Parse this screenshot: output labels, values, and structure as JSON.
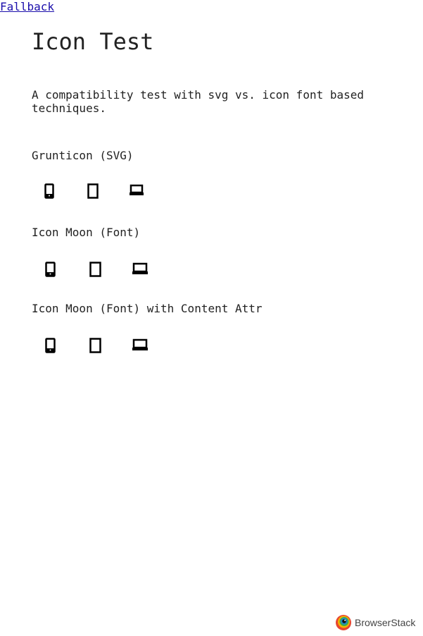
{
  "fallback_link": "Fallback",
  "title": "Icon Test",
  "description": "A compatibility test with svg vs. icon font based techniques.",
  "sections": [
    {
      "heading": "Grunticon (SVG)",
      "icons": [
        "phone-icon",
        "tablet-icon",
        "laptop-icon"
      ]
    },
    {
      "heading": "Icon Moon (Font)",
      "icons": [
        "phone-icon",
        "tablet-icon",
        "laptop-icon"
      ]
    },
    {
      "heading": "Icon Moon (Font) with Content Attr",
      "icons": [
        "phone-icon",
        "tablet-icon",
        "laptop-icon"
      ]
    }
  ],
  "footer": {
    "brand": "BrowserStack",
    "logo_icon": "browserstack-logo-icon"
  },
  "colors": {
    "text": "#222222",
    "link": "#1a0dab",
    "icon": "#000000"
  }
}
